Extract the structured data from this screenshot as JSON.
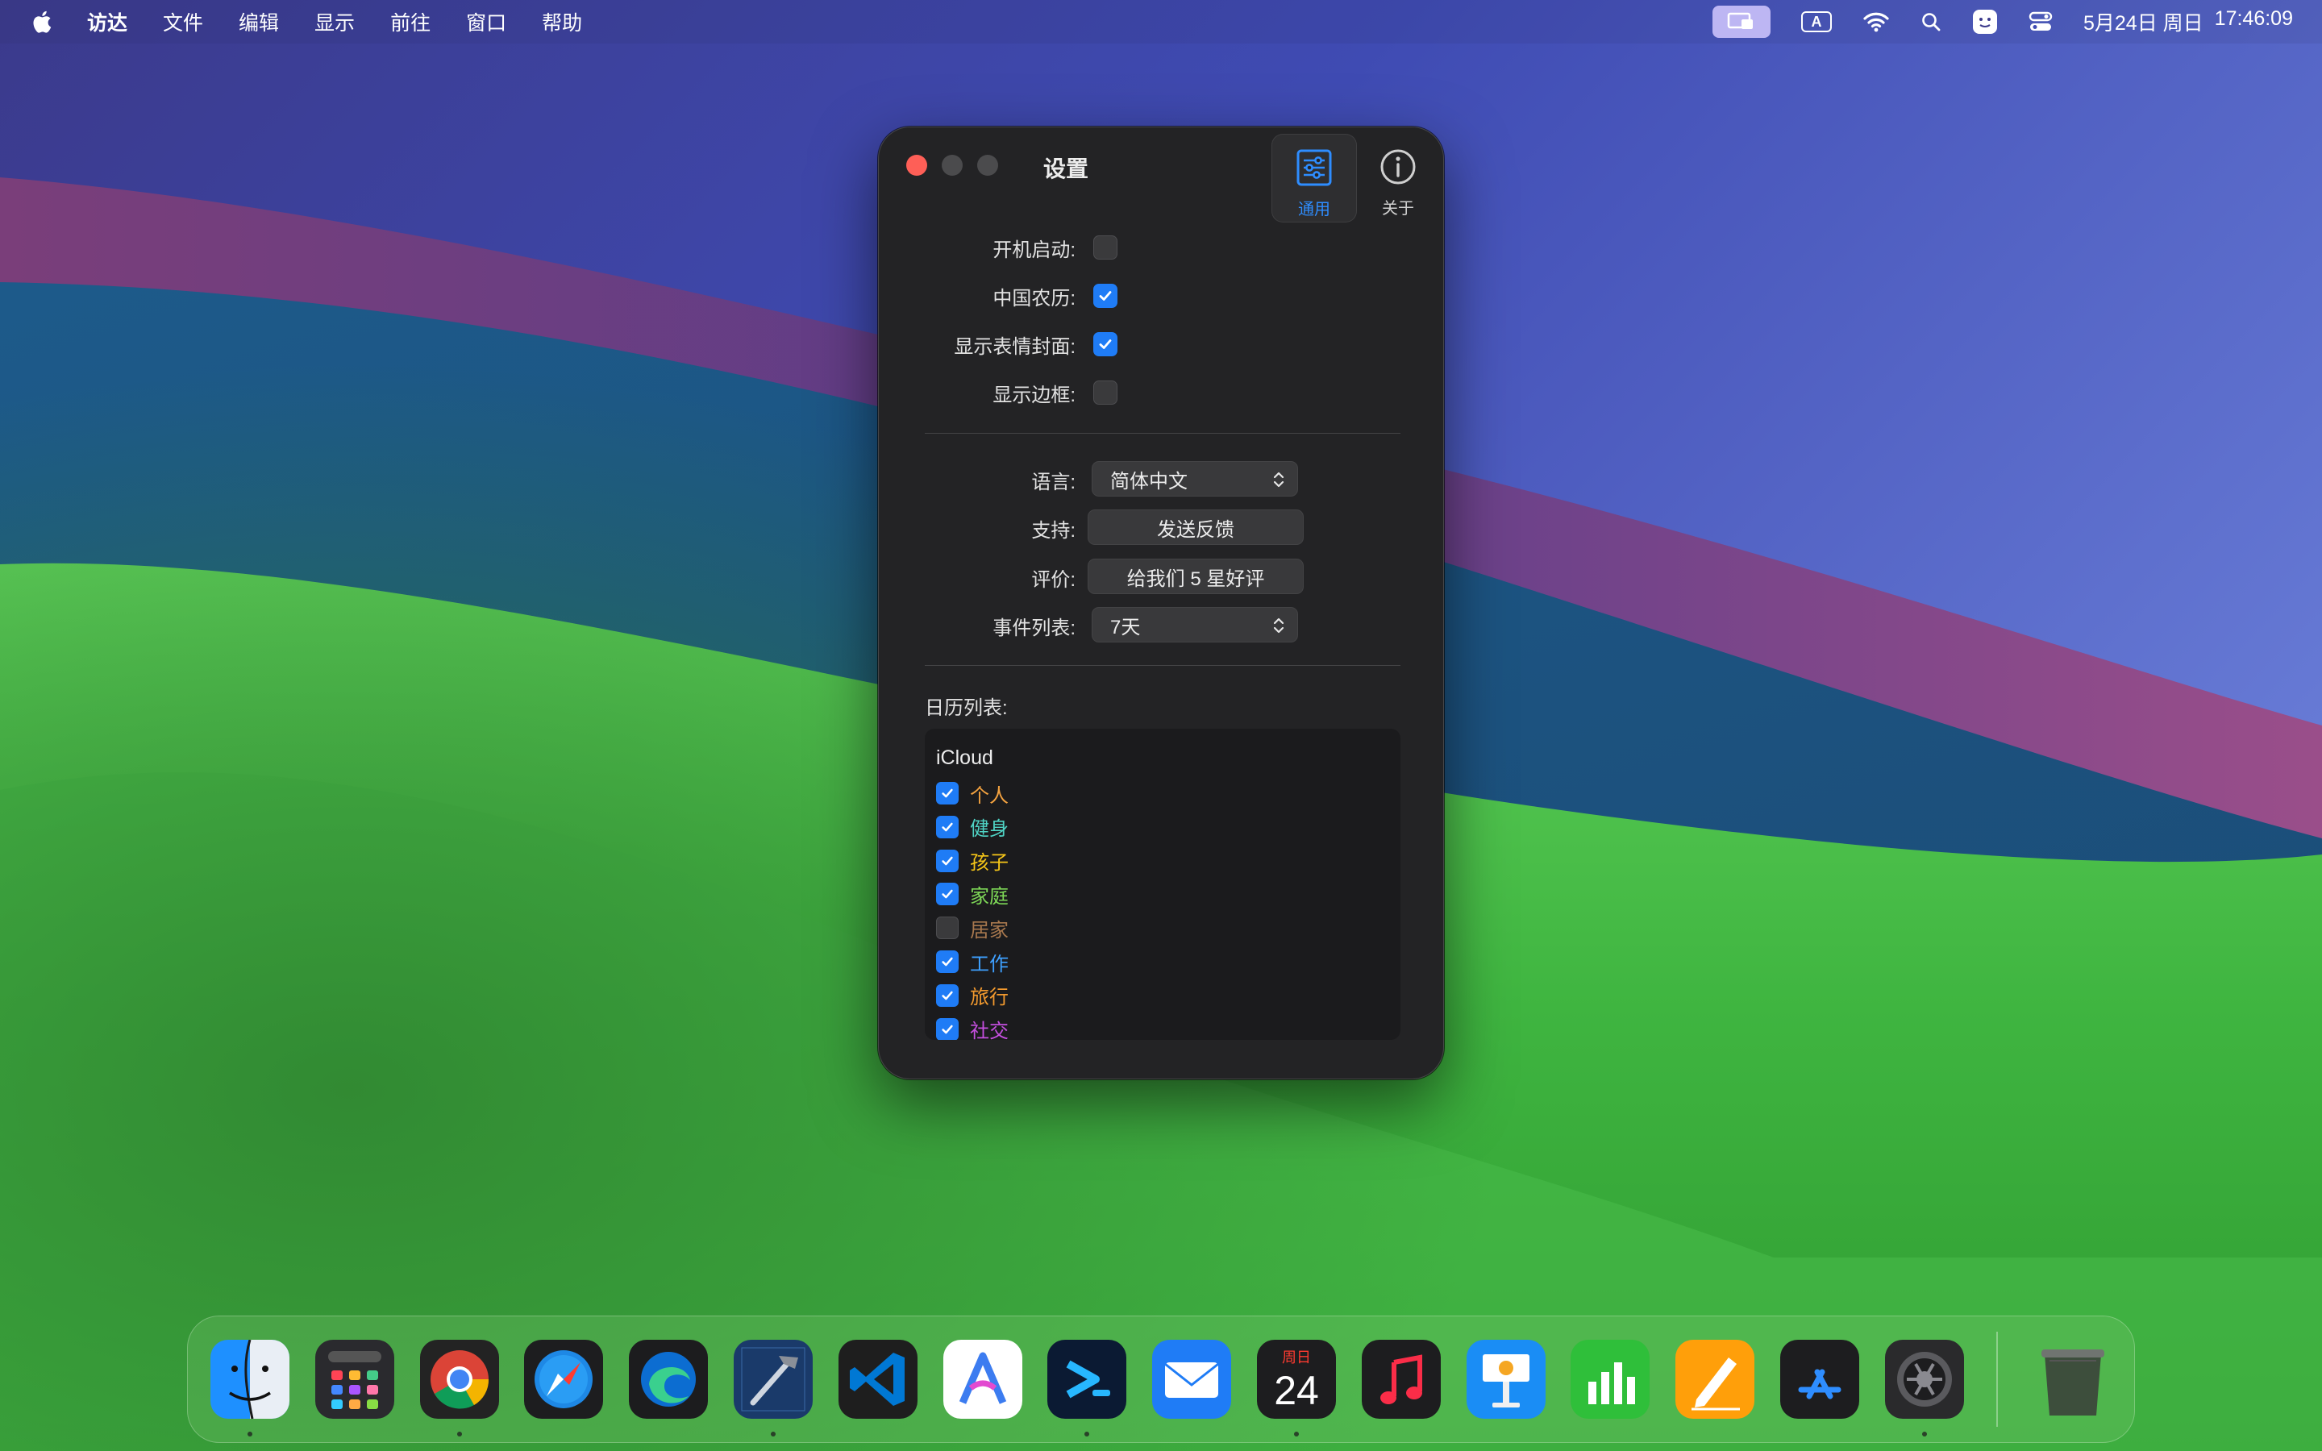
{
  "menubar": {
    "app_name": "访达",
    "menus": [
      "文件",
      "编辑",
      "显示",
      "前往",
      "窗口",
      "帮助"
    ],
    "status_icons": [
      "screen-sharing-icon",
      "input-method-icon",
      "wifi-icon",
      "spotlight-search-icon",
      "app-face-icon",
      "control-center-icon"
    ],
    "input_method_label": "A",
    "date": "5月24日 周日",
    "time": "17:46:09"
  },
  "window": {
    "title": "设置",
    "tabs": [
      {
        "label": "通用",
        "icon": "sliders-icon",
        "selected": true
      },
      {
        "label": "关于",
        "icon": "info-icon",
        "selected": false
      }
    ],
    "toggles": [
      {
        "label": "开机启动:",
        "checked": false
      },
      {
        "label": "中国农历:",
        "checked": true
      },
      {
        "label": "显示表情封面:",
        "checked": true
      },
      {
        "label": "显示边框:",
        "checked": false
      }
    ],
    "language": {
      "label": "语言:",
      "value": "简体中文"
    },
    "support": {
      "label": "支持:",
      "button": "发送反馈"
    },
    "rating": {
      "label": "评价:",
      "button": "给我们 5 星好评"
    },
    "event_list": {
      "label": "事件列表:",
      "value": "7天"
    },
    "calendar_list": {
      "label": "日历列表:",
      "account": "iCloud",
      "items": [
        {
          "name": "个人",
          "checked": true,
          "color": "#f4a340"
        },
        {
          "name": "健身",
          "checked": true,
          "color": "#4fd3c4"
        },
        {
          "name": "孩子",
          "checked": true,
          "color": "#f5c518"
        },
        {
          "name": "家庭",
          "checked": true,
          "color": "#7ed957"
        },
        {
          "name": "居家",
          "checked": false,
          "color": "#a8784e"
        },
        {
          "name": "工作",
          "checked": true,
          "color": "#3ea0ff"
        },
        {
          "name": "旅行",
          "checked": true,
          "color": "#f39a2e"
        },
        {
          "name": "社交",
          "checked": true,
          "color": "#c64fe0"
        }
      ]
    }
  },
  "dock": {
    "apps": [
      {
        "name": "Finder",
        "icon": "finder-icon",
        "running": true
      },
      {
        "name": "Launchpad",
        "icon": "launchpad-icon",
        "running": false
      },
      {
        "name": "Google Chrome",
        "icon": "chrome-icon",
        "running": true
      },
      {
        "name": "Safari",
        "icon": "safari-icon",
        "running": false
      },
      {
        "name": "Microsoft Edge",
        "icon": "edge-icon",
        "running": false
      },
      {
        "name": "Xcode",
        "icon": "xcode-icon",
        "running": true
      },
      {
        "name": "Visual Studio Code",
        "icon": "vscode-icon",
        "running": false
      },
      {
        "name": "Arc-style browser",
        "icon": "a-logo-app-icon",
        "running": false
      },
      {
        "name": "Prompt",
        "icon": "prompt-icon",
        "running": true
      },
      {
        "name": "Mail",
        "icon": "mail-icon",
        "running": false
      },
      {
        "name": "Calendar",
        "icon": "calendar-icon",
        "running": true
      },
      {
        "name": "Music",
        "icon": "music-icon",
        "running": false
      },
      {
        "name": "Keynote",
        "icon": "keynote-icon",
        "running": false
      },
      {
        "name": "Numbers",
        "icon": "numbers-icon",
        "running": false
      },
      {
        "name": "Pages",
        "icon": "pages-icon",
        "running": false
      },
      {
        "name": "App Store",
        "icon": "app-store-icon",
        "running": false
      },
      {
        "name": "System Settings",
        "icon": "system-settings-icon",
        "running": true
      }
    ],
    "calendar_icon_weekday": "周日",
    "calendar_icon_day": "24",
    "trash": {
      "name": "Trash",
      "icon": "trash-icon"
    }
  },
  "colors": {
    "accent": "#1f7cf6",
    "window_bg": "#232325",
    "close_button": "#fe5f57"
  }
}
